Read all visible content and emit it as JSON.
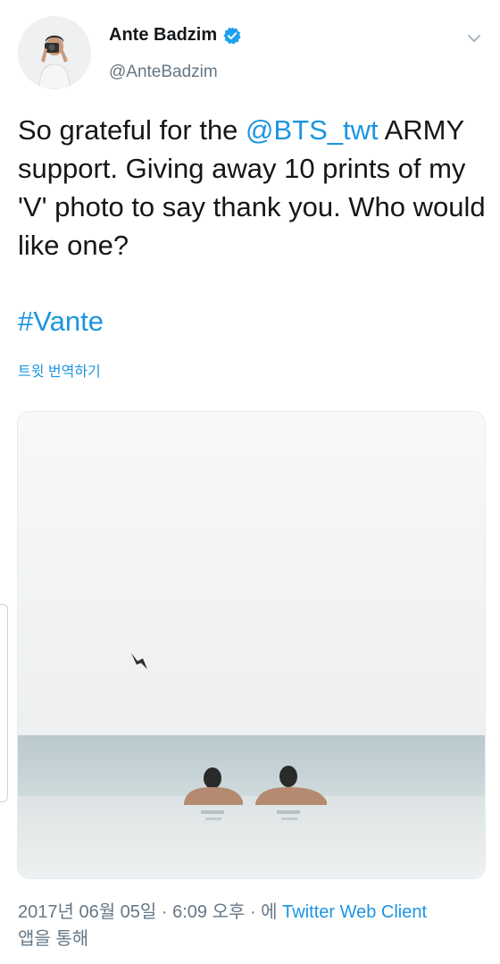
{
  "author": {
    "display_name": "Ante Badzim",
    "handle": "@AnteBadzim",
    "verified": true
  },
  "tweet": {
    "text_prefix": "So grateful for the ",
    "mention": "@BTS_twt",
    "text_suffix": " ARMY support. Giving away 10 prints of my 'V' photo to say thank you. Who would like one?",
    "hashtag": "#Vante",
    "translate_label": "트윗 번역하기"
  },
  "meta": {
    "date": "2017년 06월 05일",
    "separator": " · ",
    "time": "6:09 오후",
    "via_prefix": "에 ",
    "source": "Twitter Web Client",
    "via_suffix": "앱을 통해"
  },
  "icons": {
    "verified": "verified-badge-icon",
    "menu": "chevron-down-icon"
  },
  "colors": {
    "link": "#1b95e0",
    "secondary_text": "#657786",
    "primary_text": "#14171a",
    "verified": "#1da1f2"
  }
}
